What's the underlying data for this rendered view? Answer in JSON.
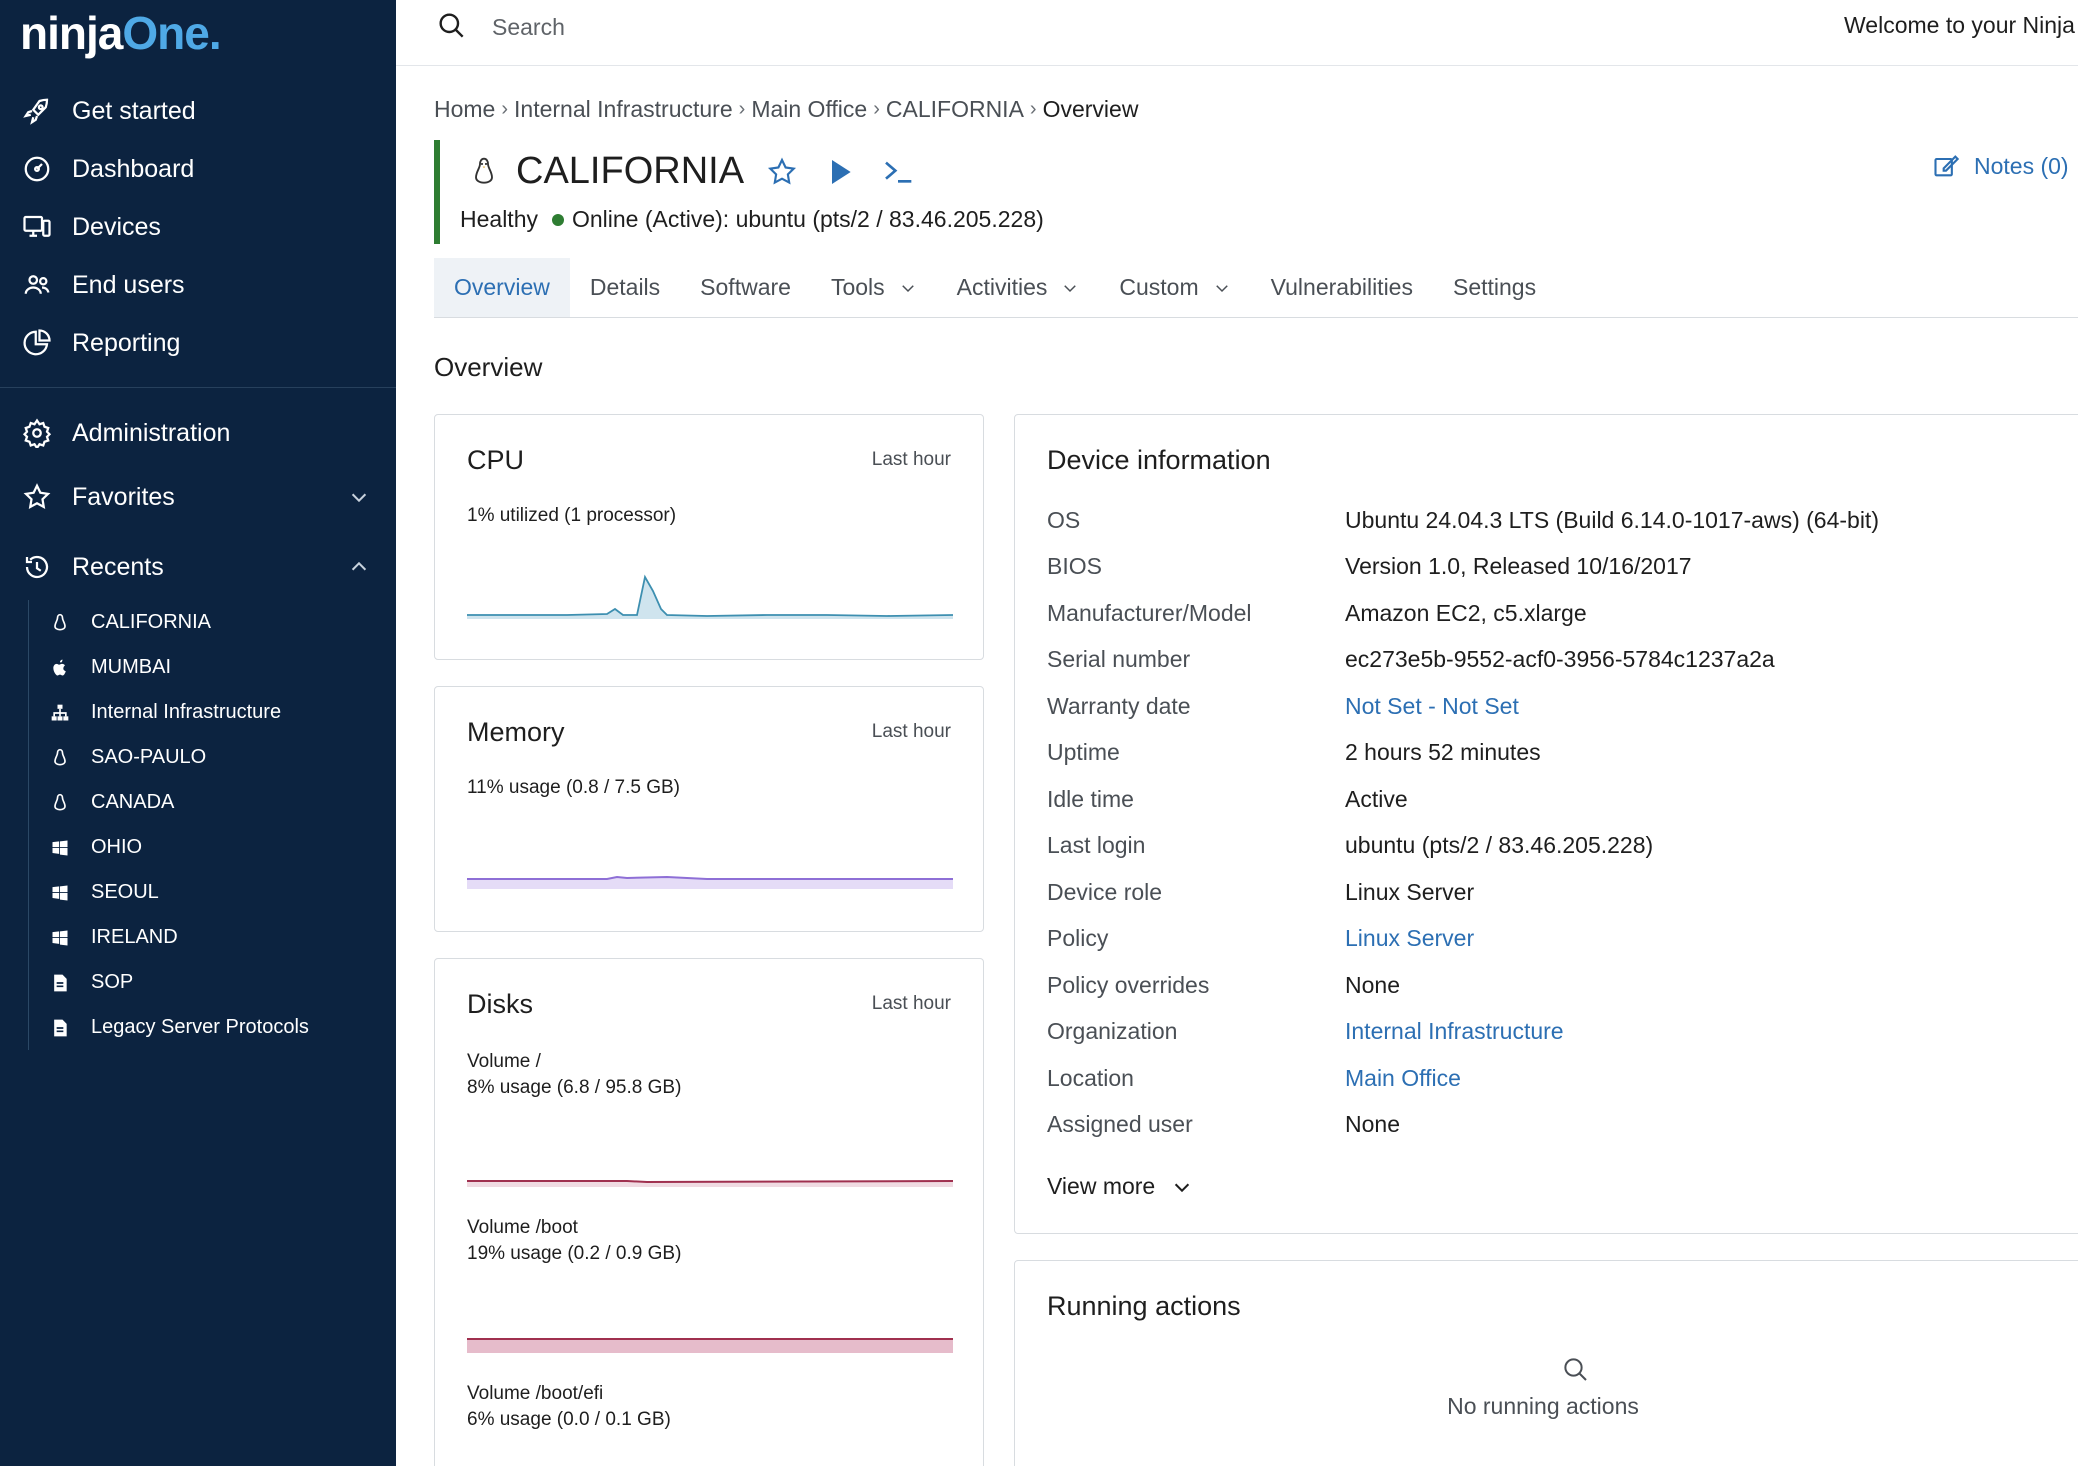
{
  "brand": {
    "logo_part1": "ninja",
    "logo_part2": "One",
    "logo_dot": "."
  },
  "sidebar": {
    "primary": [
      {
        "label": "Get started",
        "icon": "rocket-icon"
      },
      {
        "label": "Dashboard",
        "icon": "dashboard-icon"
      },
      {
        "label": "Devices",
        "icon": "devices-icon"
      },
      {
        "label": "End users",
        "icon": "users-icon"
      },
      {
        "label": "Reporting",
        "icon": "pie-chart-icon"
      }
    ],
    "secondary": [
      {
        "label": "Administration",
        "icon": "gear-icon"
      },
      {
        "label": "Favorites",
        "icon": "star-icon",
        "chevron": "chevron-down-icon"
      },
      {
        "label": "Recents",
        "icon": "history-icon",
        "chevron": "chevron-up-icon"
      }
    ],
    "recents": [
      {
        "label": "CALIFORNIA",
        "icon": "linux-icon"
      },
      {
        "label": "MUMBAI",
        "icon": "apple-icon"
      },
      {
        "label": "Internal Infrastructure",
        "icon": "organization-icon"
      },
      {
        "label": "SAO-PAULO",
        "icon": "linux-icon"
      },
      {
        "label": "CANADA",
        "icon": "linux-icon"
      },
      {
        "label": "OHIO",
        "icon": "windows-icon"
      },
      {
        "label": "SEOUL",
        "icon": "windows-icon"
      },
      {
        "label": "IRELAND",
        "icon": "windows-icon"
      },
      {
        "label": "SOP",
        "icon": "document-icon"
      },
      {
        "label": "Legacy Server Protocols",
        "icon": "document-icon"
      }
    ]
  },
  "topbar": {
    "search_placeholder": "Search",
    "welcome": "Welcome to your Ninja"
  },
  "breadcrumb": [
    "Home",
    "Internal Infrastructure",
    "Main Office",
    "CALIFORNIA",
    "Overview"
  ],
  "device": {
    "name": "CALIFORNIA",
    "health": "Healthy",
    "status": "Online (Active): ubuntu (pts/2 / 83.46.205.228)",
    "notes_label": "Notes (0)"
  },
  "tabs": [
    {
      "label": "Overview",
      "active": true
    },
    {
      "label": "Details"
    },
    {
      "label": "Software"
    },
    {
      "label": "Tools",
      "dropdown": true
    },
    {
      "label": "Activities",
      "dropdown": true
    },
    {
      "label": "Custom",
      "dropdown": true
    },
    {
      "label": "Vulnerabilities"
    },
    {
      "label": "Settings"
    }
  ],
  "overview_title": "Overview",
  "cpu": {
    "title": "CPU",
    "range": "Last hour",
    "summary": "1% utilized (1 processor)"
  },
  "memory": {
    "title": "Memory",
    "range": "Last hour",
    "summary": "11% usage (0.8 / 7.5 GB)"
  },
  "disks": {
    "title": "Disks",
    "range": "Last hour",
    "volumes": [
      {
        "name": "Volume /",
        "usage": "8% usage (6.8 / 95.8 GB)",
        "percent": 8
      },
      {
        "name": "Volume /boot",
        "usage": "19% usage (0.2 / 0.9 GB)",
        "percent": 19
      },
      {
        "name": "Volume /boot/efi",
        "usage": "6% usage (0.0 / 0.1 GB)",
        "percent": 6
      }
    ]
  },
  "device_info": {
    "title": "Device information",
    "rows": [
      {
        "label": "OS",
        "value": "Ubuntu 24.04.3 LTS (Build 6.14.0-1017-aws) (64-bit)"
      },
      {
        "label": "BIOS",
        "value": "Version 1.0, Released 10/16/2017"
      },
      {
        "label": "Manufacturer/Model",
        "value": "Amazon EC2, c5.xlarge"
      },
      {
        "label": "Serial number",
        "value": "ec273e5b-9552-acf0-3956-5784c1237a2a"
      },
      {
        "label": "Warranty date",
        "value": "Not Set - Not Set",
        "link": true
      },
      {
        "label": "Uptime",
        "value": "2 hours 52 minutes"
      },
      {
        "label": "Idle time",
        "value": "Active"
      },
      {
        "label": "Last login",
        "value": "ubuntu (pts/2 / 83.46.205.228)"
      },
      {
        "label": "Device role",
        "value": "Linux Server"
      },
      {
        "label": "Policy",
        "value": "Linux Server",
        "link": true
      },
      {
        "label": "Policy overrides",
        "value": "None"
      },
      {
        "label": "Organization",
        "value": "Internal Infrastructure",
        "link": true
      },
      {
        "label": "Location",
        "value": "Main Office",
        "link": true
      },
      {
        "label": "Assigned user",
        "value": "None"
      }
    ],
    "view_more": "View more"
  },
  "running_actions": {
    "title": "Running actions",
    "empty": "No running actions"
  },
  "colors": {
    "sidebar_bg": "#0c2340",
    "accent": "#2c6fb3",
    "healthy": "#2e7d32",
    "cpu_line": "#3d8fb0",
    "memory_line": "#8e6fd6",
    "disk_line": "#a0304f"
  }
}
